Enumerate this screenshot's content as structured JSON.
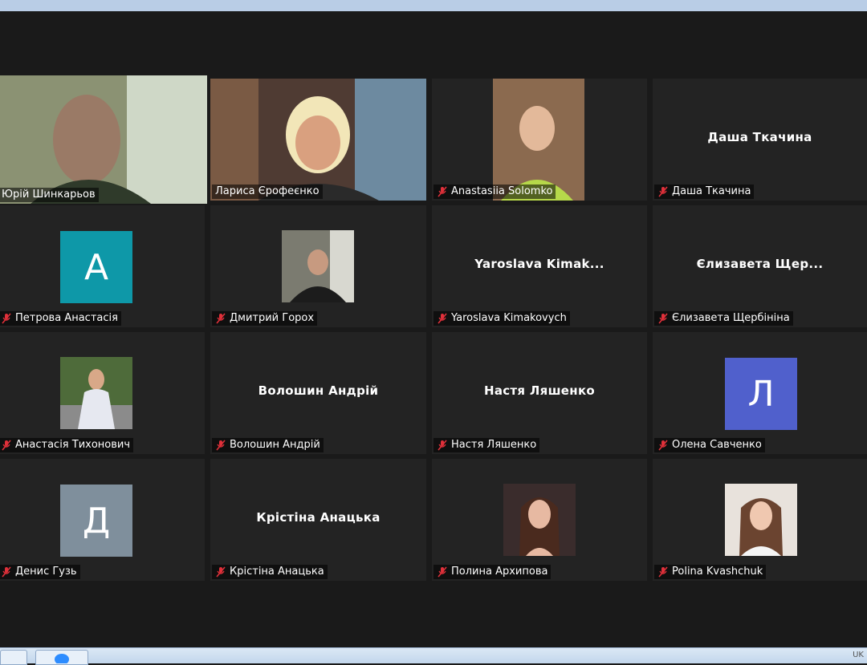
{
  "gallery": {
    "participants": [
      {
        "name": "Юрій Шинкарьов",
        "label_text": "Юрій Шинкарьов",
        "muted": false,
        "type": "video"
      },
      {
        "name": "Лариса Єрофеєнко",
        "label_text": "Лариса Єрофеєнко",
        "muted": false,
        "type": "video"
      },
      {
        "name": "Anastasiia Solomko",
        "label_text": "Anastasiia Solomko",
        "muted": true,
        "type": "video"
      },
      {
        "name": "Даша Ткачина",
        "label_text": "Даша Ткачина",
        "big_text": "Даша Ткачина",
        "muted": true,
        "type": "name"
      },
      {
        "name": "Петрова Анастасія",
        "label_text": "Петрова Анастасія",
        "initial": "А",
        "avatar_color": "#0e98a8",
        "muted": true,
        "type": "avatar"
      },
      {
        "name": "Дмитрий Горох",
        "label_text": "Дмитрий Горох",
        "muted": true,
        "type": "photo"
      },
      {
        "name": "Yaroslava Kimakovych",
        "label_text": "Yaroslava Kimakovych",
        "big_text": "Yaroslava  Kimak...",
        "muted": true,
        "type": "name"
      },
      {
        "name": "Єлизавета Щербініна",
        "label_text": "Єлизавета Щербініна",
        "big_text": "Єлизавета  Щер...",
        "muted": true,
        "type": "name"
      },
      {
        "name": "Анастасія Тихонович",
        "label_text": "Анастасія Тихонович",
        "muted": true,
        "type": "photo"
      },
      {
        "name": "Волошин Андрій",
        "label_text": "Волошин Андрій",
        "big_text": "Волошин Андрій",
        "muted": true,
        "type": "name"
      },
      {
        "name": "Настя Ляшенко",
        "label_text": "Настя Ляшенко",
        "big_text": "Настя Ляшенко",
        "muted": true,
        "type": "name"
      },
      {
        "name": "Олена Савченко",
        "label_text": "Олена Савченко",
        "initial": "Л",
        "avatar_color": "#5060cc",
        "muted": true,
        "type": "avatar"
      },
      {
        "name": "Денис Гузь",
        "label_text": "Денис Гузь",
        "initial": "Д",
        "avatar_color": "#7f8f9c",
        "muted": true,
        "type": "avatar"
      },
      {
        "name": "Крістіна Анацька",
        "label_text": "Крістіна Анацька",
        "big_text": "Крістіна Анацька",
        "muted": true,
        "type": "name"
      },
      {
        "name": "Полина Архипова",
        "label_text": "Полина Архипова",
        "muted": true,
        "type": "photo"
      },
      {
        "name": "Polina Kvashchuk",
        "label_text": "Polina Kvashchuk",
        "muted": true,
        "type": "photo"
      }
    ]
  },
  "colors": {
    "active_speaker": "#c7e03a",
    "mute": "#e0303a",
    "tile_bg": "#232323"
  },
  "taskbar": {
    "lang": "UK"
  }
}
